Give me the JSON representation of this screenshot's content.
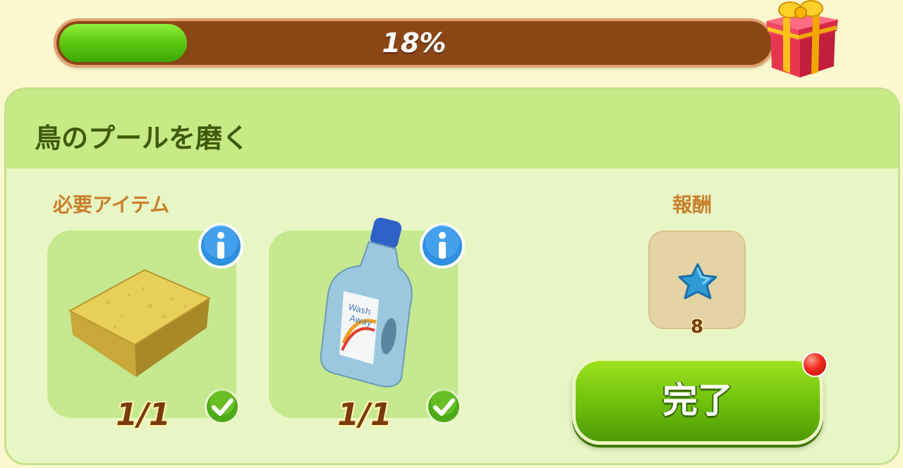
{
  "progress": {
    "percent_label": "18%",
    "fraction": 0.18
  },
  "quest": {
    "title": "鳥のプールを磨く"
  },
  "sections": {
    "required_items_label": "必要アイテム",
    "reward_label": "報酬"
  },
  "items": [
    {
      "name": "sponge",
      "count": "1/1",
      "completed": true
    },
    {
      "name": "wash-away-detergent",
      "count": "1/1",
      "completed": true,
      "bottle_text": [
        "Wash",
        "Away"
      ]
    }
  ],
  "reward": {
    "icon": "blue-star-icon",
    "amount": "8"
  },
  "complete_button": {
    "label": "完了"
  },
  "colors": {
    "progress_fill": "#5fcc14",
    "track": "#8b4616",
    "panel": "#e8f6c6",
    "accent_orange": "#c97f2c",
    "button_green": "#6cbf0c"
  }
}
